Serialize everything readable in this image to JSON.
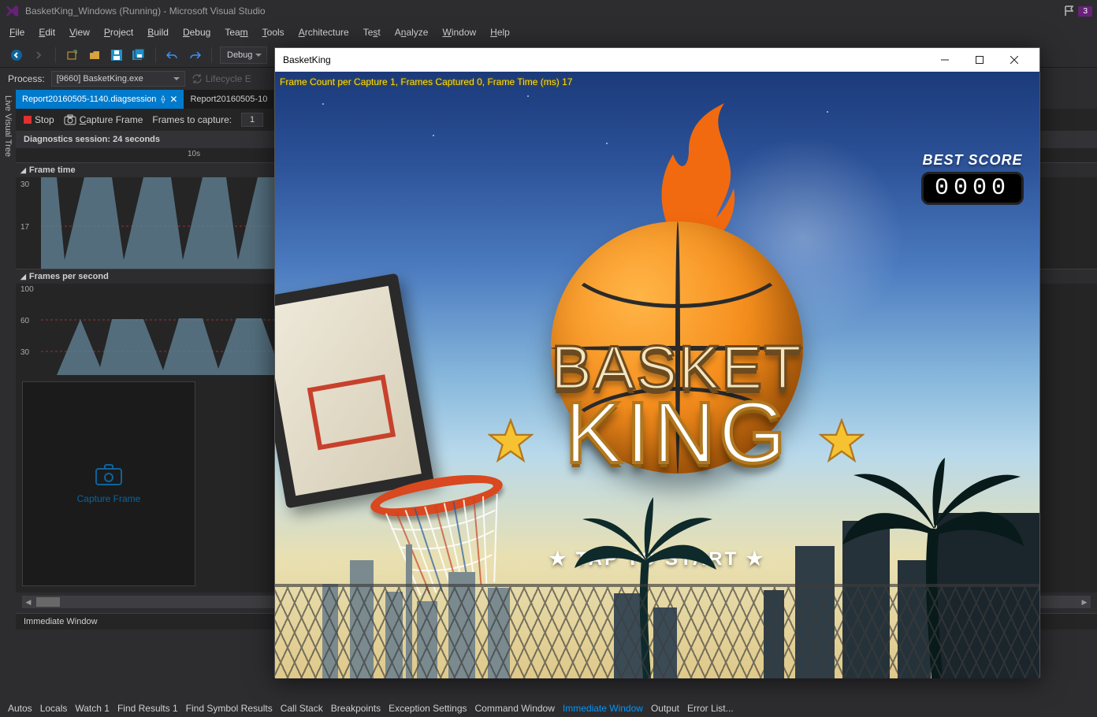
{
  "title": "BasketKing_Windows (Running) - Microsoft Visual Studio",
  "notification_count": "3",
  "menu": [
    "File",
    "Edit",
    "View",
    "Project",
    "Build",
    "Debug",
    "Team",
    "Tools",
    "Architecture",
    "Test",
    "Analyze",
    "Window",
    "Help"
  ],
  "toolbar": {
    "config": "Debug"
  },
  "process": {
    "label": "Process:",
    "value": "[9660] BasketKing.exe",
    "lifecycle": "Lifecycle E"
  },
  "tabs": [
    {
      "label": "Report20160505-1140.diagsession",
      "active": true
    },
    {
      "label": "Report20160505-10",
      "active": false
    }
  ],
  "diag": {
    "stop": "Stop",
    "capture": "Capture Frame",
    "frames_label": "Frames to capture:",
    "frames_value": "1",
    "session": "Diagnostics session: 24 seconds",
    "ruler_tick": "10s",
    "chart1": {
      "title": "Frame time",
      "y1": "30",
      "y2": "17"
    },
    "chart2": {
      "title": "Frames per second",
      "y0": "100",
      "y1": "60",
      "y2": "30"
    },
    "capture_link": "Capture Frame"
  },
  "immediate": {
    "header": "Immediate Window"
  },
  "bottom_tabs": [
    "Autos",
    "Locals",
    "Watch 1",
    "Find Results 1",
    "Find Symbol Results",
    "Call Stack",
    "Breakpoints",
    "Exception Settings",
    "Command Window",
    "Immediate Window",
    "Output",
    "Error List..."
  ],
  "bottom_active_index": 9,
  "left_rail": "Live Visual Tree",
  "game": {
    "window_title": "BasketKing",
    "frame_text": "Frame Count per Capture 1, Frames Captured 0, Frame Time (ms) 17",
    "best_label": "BEST SCORE",
    "best_value": "0000",
    "logo_top": "BASKET",
    "logo_bottom": "KING",
    "tap": "★ TAP TO START ★"
  }
}
